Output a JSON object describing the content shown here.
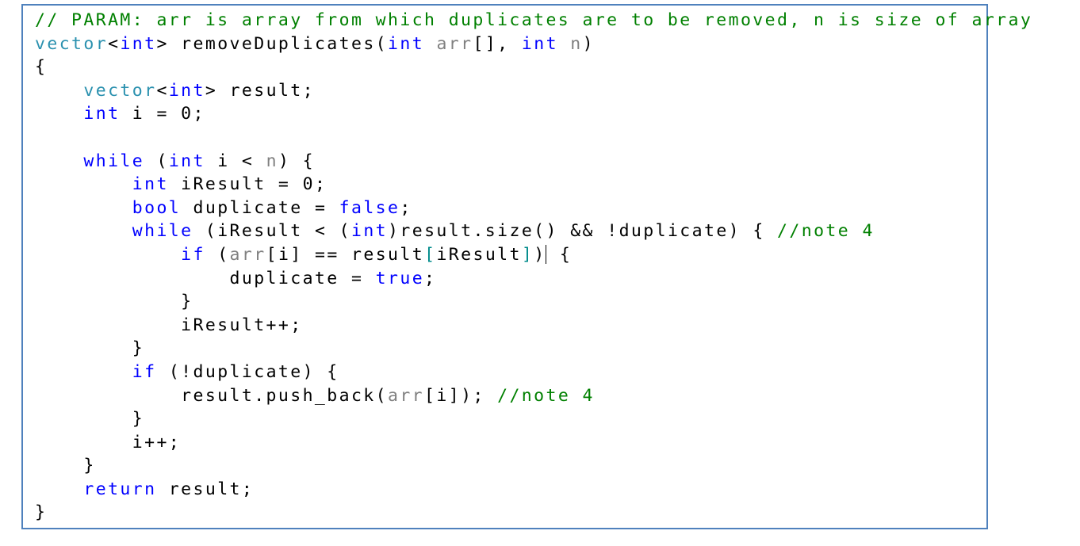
{
  "editor": {
    "colors": {
      "border": "#4f81bd",
      "comment": "#008000",
      "keyword": "#0000ff",
      "type": "#2b91af",
      "parameter": "#808080",
      "plain": "#000000"
    },
    "caret": {
      "line": 11,
      "after_token": 5
    },
    "lines": [
      [
        {
          "t": "comment",
          "s": "// PARAM: arr is array from which duplicates are to be removed, n is size of array"
        }
      ],
      [
        {
          "t": "type",
          "s": "vector"
        },
        {
          "t": "plain",
          "s": "<"
        },
        {
          "t": "keyword",
          "s": "int"
        },
        {
          "t": "plain",
          "s": "> removeDuplicates("
        },
        {
          "t": "keyword",
          "s": "int"
        },
        {
          "t": "plain",
          "s": " "
        },
        {
          "t": "param",
          "s": "arr"
        },
        {
          "t": "plain",
          "s": "[], "
        },
        {
          "t": "keyword",
          "s": "int"
        },
        {
          "t": "plain",
          "s": " "
        },
        {
          "t": "param",
          "s": "n"
        },
        {
          "t": "plain",
          "s": ")"
        }
      ],
      [
        {
          "t": "plain",
          "s": "{"
        }
      ],
      [
        {
          "t": "plain",
          "s": "\t"
        },
        {
          "t": "type",
          "s": "vector"
        },
        {
          "t": "plain",
          "s": "<"
        },
        {
          "t": "keyword",
          "s": "int"
        },
        {
          "t": "plain",
          "s": "> result;"
        }
      ],
      [
        {
          "t": "plain",
          "s": "\t"
        },
        {
          "t": "keyword",
          "s": "int"
        },
        {
          "t": "plain",
          "s": " i = 0;"
        }
      ],
      [
        {
          "t": "plain",
          "s": ""
        }
      ],
      [
        {
          "t": "plain",
          "s": "\t"
        },
        {
          "t": "keyword",
          "s": "while"
        },
        {
          "t": "plain",
          "s": " ("
        },
        {
          "t": "keyword",
          "s": "int"
        },
        {
          "t": "plain",
          "s": " i < "
        },
        {
          "t": "param",
          "s": "n"
        },
        {
          "t": "plain",
          "s": ") {"
        }
      ],
      [
        {
          "t": "plain",
          "s": "\t\t"
        },
        {
          "t": "keyword",
          "s": "int"
        },
        {
          "t": "plain",
          "s": " iResult = 0;"
        }
      ],
      [
        {
          "t": "plain",
          "s": "\t\t"
        },
        {
          "t": "keyword",
          "s": "bool"
        },
        {
          "t": "plain",
          "s": " duplicate = "
        },
        {
          "t": "keyword",
          "s": "false"
        },
        {
          "t": "plain",
          "s": ";"
        }
      ],
      [
        {
          "t": "plain",
          "s": "\t\t"
        },
        {
          "t": "keyword",
          "s": "while"
        },
        {
          "t": "plain",
          "s": " (iResult < ("
        },
        {
          "t": "keyword",
          "s": "int"
        },
        {
          "t": "plain",
          "s": ")result.size() && !duplicate) { "
        },
        {
          "t": "comment",
          "s": "//note 4"
        }
      ],
      [
        {
          "t": "plain",
          "s": "\t\t\t"
        },
        {
          "t": "keyword",
          "s": "if"
        },
        {
          "t": "plain",
          "s": " ("
        },
        {
          "t": "param",
          "s": "arr"
        },
        {
          "t": "plain",
          "s": "[i] == result"
        },
        {
          "t": "bracket",
          "s": "["
        },
        {
          "t": "plain",
          "s": "iResult"
        },
        {
          "t": "bracket",
          "s": "]"
        },
        {
          "t": "plain",
          "s": ")"
        },
        {
          "t": "caret",
          "s": ""
        },
        {
          "t": "plain",
          "s": " {"
        }
      ],
      [
        {
          "t": "plain",
          "s": "\t\t\t\t"
        },
        {
          "t": "plain",
          "s": "duplicate = "
        },
        {
          "t": "keyword",
          "s": "true"
        },
        {
          "t": "plain",
          "s": ";"
        }
      ],
      [
        {
          "t": "plain",
          "s": "\t\t\t}"
        }
      ],
      [
        {
          "t": "plain",
          "s": "\t\t\tiResult++;"
        }
      ],
      [
        {
          "t": "plain",
          "s": "\t\t}"
        }
      ],
      [
        {
          "t": "plain",
          "s": "\t\t"
        },
        {
          "t": "keyword",
          "s": "if"
        },
        {
          "t": "plain",
          "s": " (!duplicate) {"
        }
      ],
      [
        {
          "t": "plain",
          "s": "\t\t\tresult.push_back("
        },
        {
          "t": "param",
          "s": "arr"
        },
        {
          "t": "plain",
          "s": "[i]); "
        },
        {
          "t": "comment",
          "s": "//note 4"
        }
      ],
      [
        {
          "t": "plain",
          "s": "\t\t}"
        }
      ],
      [
        {
          "t": "plain",
          "s": "\t\ti++;"
        }
      ],
      [
        {
          "t": "plain",
          "s": "\t}"
        }
      ],
      [
        {
          "t": "plain",
          "s": "\t"
        },
        {
          "t": "keyword",
          "s": "return"
        },
        {
          "t": "plain",
          "s": " result;"
        }
      ],
      [
        {
          "t": "plain",
          "s": "}"
        }
      ]
    ]
  }
}
